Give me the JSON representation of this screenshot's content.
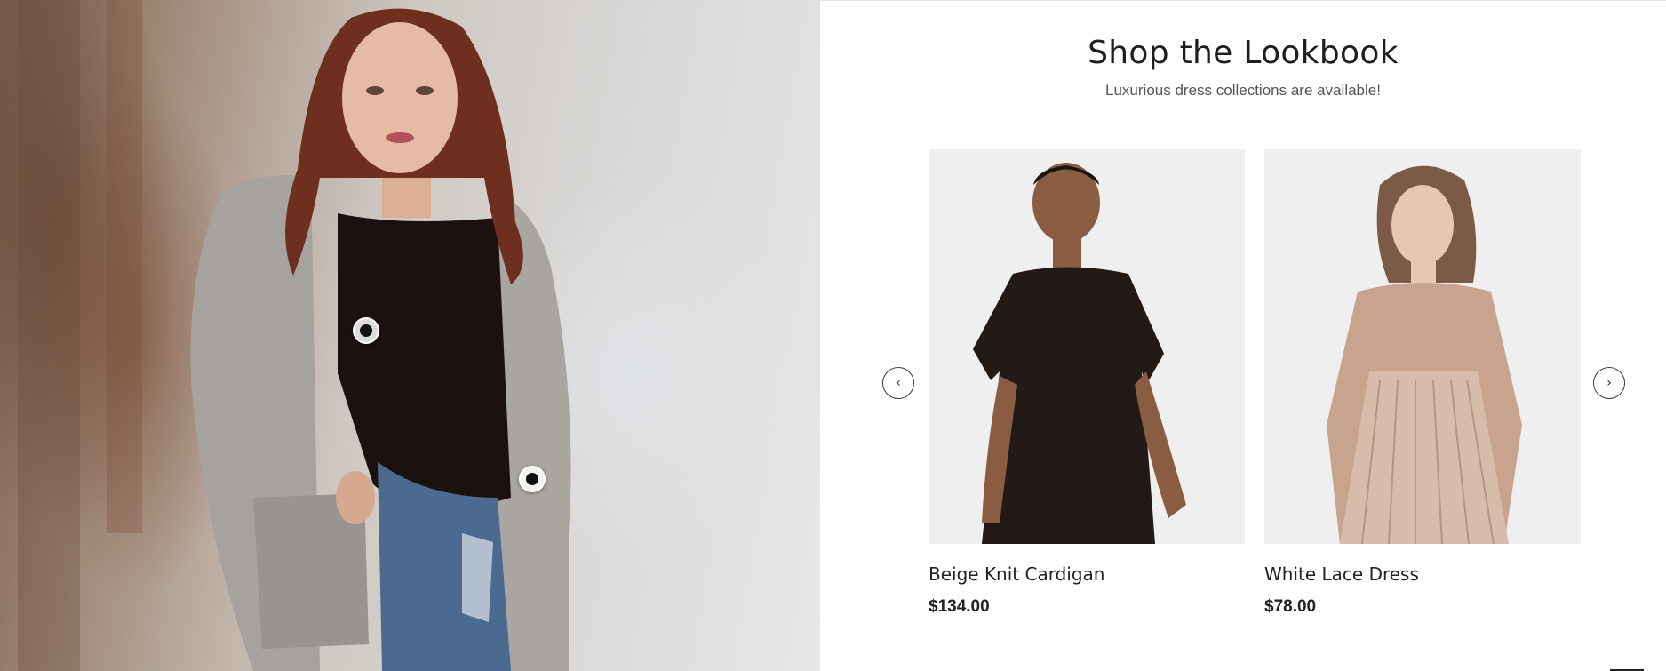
{
  "lookbook": {
    "title": "Shop the Lookbook",
    "subtitle": "Luxurious dress collections are available!"
  },
  "hero": {
    "image": "woman-in-grey-cardigan-snowy-forest",
    "hotspot_count": 2
  },
  "carousel": {
    "prev_icon": "chevron-left-icon",
    "next_icon": "chevron-right-icon",
    "prev_glyph": "‹",
    "next_glyph": "›",
    "products": [
      {
        "name": "Beige Knit Cardigan",
        "price": "$134.00",
        "image": "black-tshirt-dress-model"
      },
      {
        "name": "White Lace Dress",
        "price": "$78.00",
        "image": "sequin-pleated-dress-model"
      }
    ]
  },
  "colors": {
    "text": "#1f1f1f",
    "card_bg": "#efefef",
    "hotspot_dot": "#111111"
  }
}
